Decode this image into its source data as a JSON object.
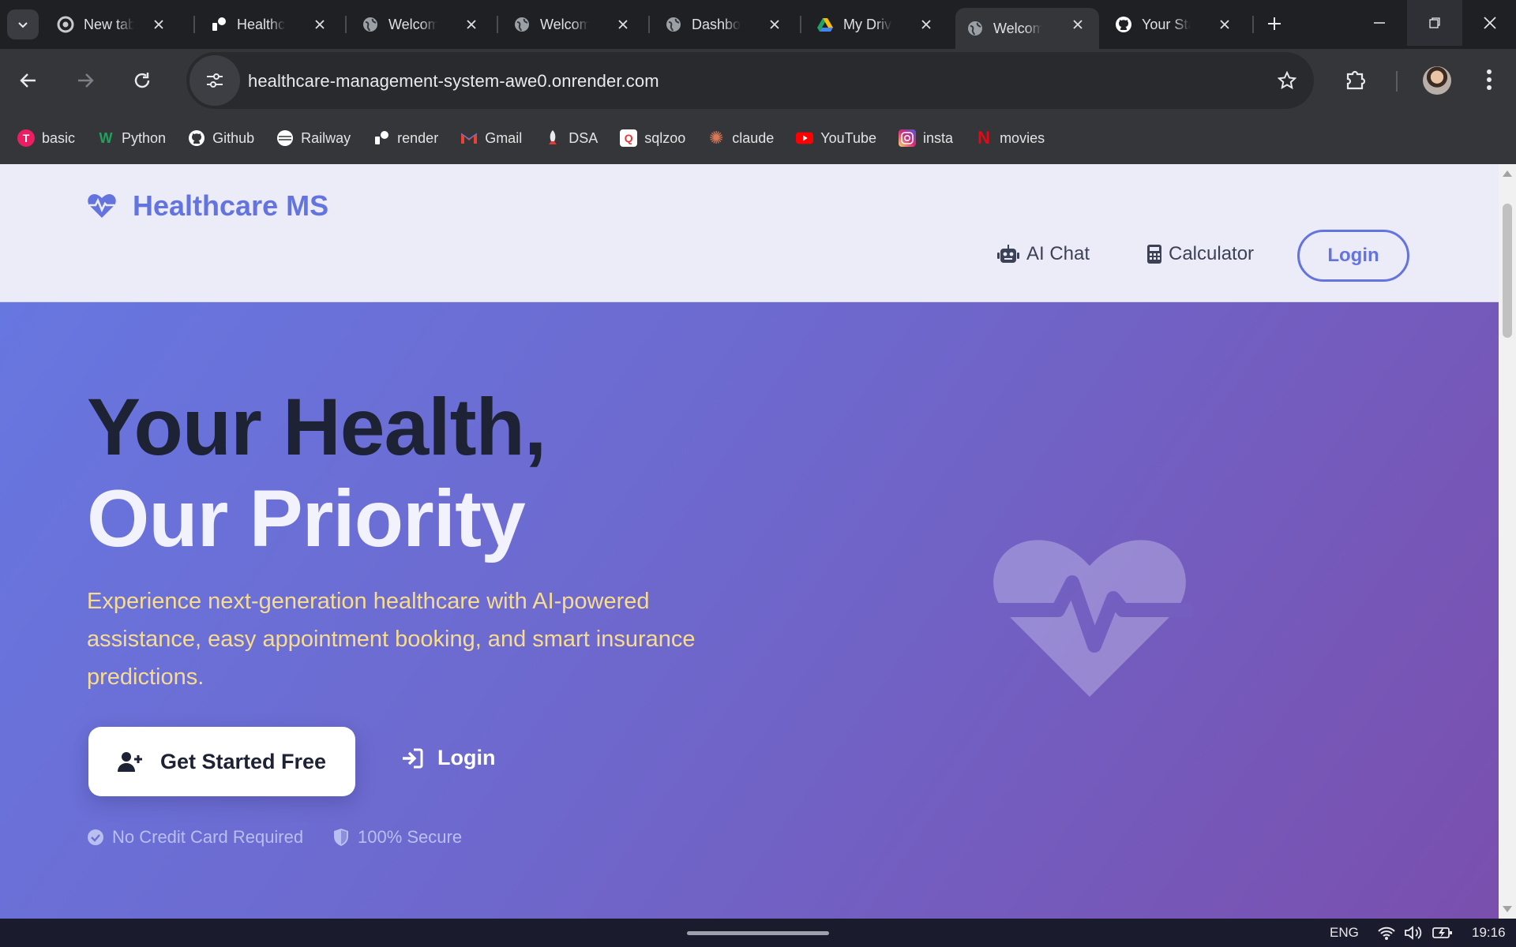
{
  "browser": {
    "tabs": [
      {
        "title": "New tab",
        "icon": "chrome-icon"
      },
      {
        "title": "Healthcare",
        "icon": "render-icon"
      },
      {
        "title": "Welcome",
        "icon": "globe-icon"
      },
      {
        "title": "Welcome",
        "icon": "globe-icon"
      },
      {
        "title": "Dashboard",
        "icon": "globe-icon"
      },
      {
        "title": "My Drive",
        "icon": "google-drive-icon"
      },
      {
        "title": "Welcome",
        "icon": "globe-icon",
        "active": true
      },
      {
        "title": "Your Stars",
        "icon": "github-icon"
      }
    ],
    "url": "healthcare-management-system-awe0.onrender.com",
    "bookmarks": [
      {
        "label": "basic",
        "icon": "t-icon",
        "color": "#e91e63"
      },
      {
        "label": "Python",
        "icon": "w-icon",
        "color": "#1fa35c"
      },
      {
        "label": "Github",
        "icon": "github-icon",
        "color": "#ffffff"
      },
      {
        "label": "Railway",
        "icon": "railway-icon",
        "color": "#ffffff"
      },
      {
        "label": "render",
        "icon": "render-icon",
        "color": "#ffffff"
      },
      {
        "label": "Gmail",
        "icon": "gmail-icon",
        "color": "#ea4335"
      },
      {
        "label": "DSA",
        "icon": "rocket-icon",
        "color": "#ffffff"
      },
      {
        "label": "sqlzoo",
        "icon": "sqlzoo-icon",
        "color": "#e53935"
      },
      {
        "label": "claude",
        "icon": "claude-icon",
        "color": "#d97757"
      },
      {
        "label": "YouTube",
        "icon": "youtube-icon",
        "color": "#ff0000"
      },
      {
        "label": "insta",
        "icon": "instagram-icon",
        "color": "#d62976"
      },
      {
        "label": "movies",
        "icon": "netflix-icon",
        "color": "#e50914"
      }
    ]
  },
  "site": {
    "brand": "Healthcare MS",
    "nav": {
      "ai_chat": "AI Chat",
      "calculator": "Calculator",
      "login": "Login"
    },
    "hero": {
      "title_line1": "Your Health,",
      "title_line2": "Our Priority",
      "lead": "Experience next-generation healthcare with AI-powered assistance, easy appointment booking, and smart insurance predictions.",
      "cta_primary": "Get Started Free",
      "cta_secondary": "Login",
      "trust_1": "No Credit Card Required",
      "trust_2": "100% Secure"
    },
    "colors": {
      "accent": "#6474df",
      "hero_start": "#6777e0",
      "hero_end": "#7a4fae",
      "lead_text": "#f7dc8f"
    }
  },
  "taskbar": {
    "language": "ENG",
    "time": "19:16"
  }
}
